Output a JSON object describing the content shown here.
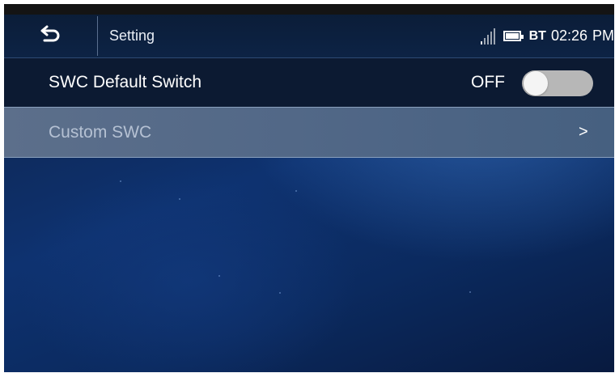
{
  "header": {
    "title": "Setting",
    "back_icon": "back-arrow-icon"
  },
  "status": {
    "signal_icon": "signal-bars-icon",
    "battery_icon": "battery-icon",
    "bt_label": "BT",
    "time": "02:26",
    "ampm": "PM"
  },
  "settings": {
    "default_switch": {
      "label": "SWC Default Switch",
      "state": "OFF"
    },
    "custom": {
      "label": "Custom SWC",
      "chevron": ">"
    }
  },
  "colors": {
    "toggle_off": "#b7b7b7",
    "selected_row": "#5c6f8b",
    "background": "#0e3270"
  }
}
